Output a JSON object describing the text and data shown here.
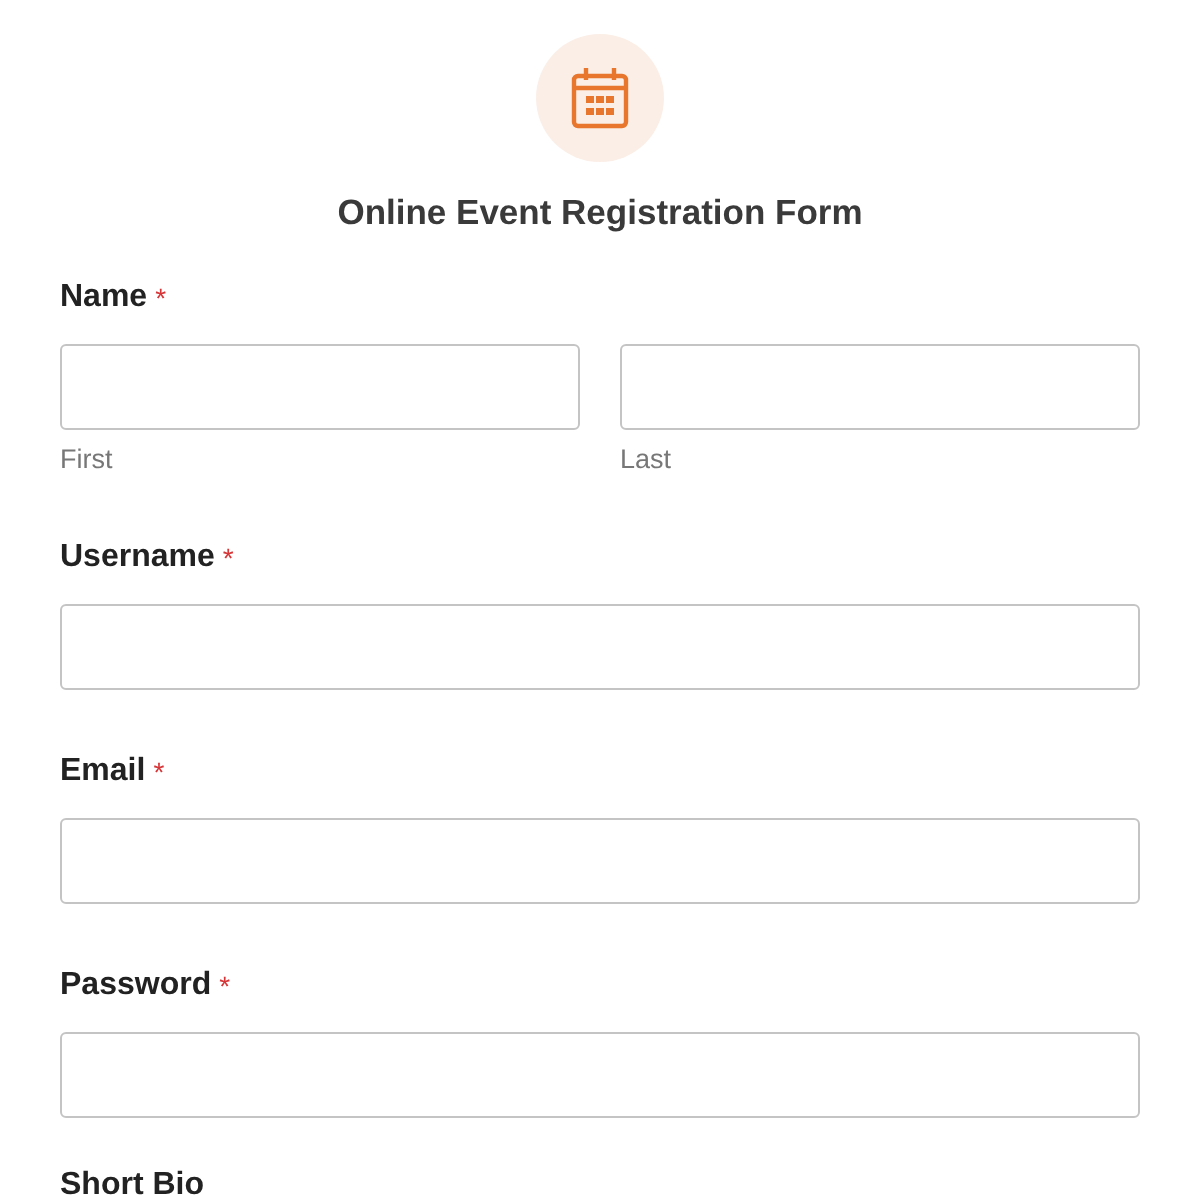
{
  "form": {
    "title": "Online Event Registration Form",
    "fields": [
      {
        "kind": "name",
        "label": "Name",
        "required_mark": "*",
        "sublabels": [
          "First",
          "Last"
        ]
      },
      {
        "kind": "text",
        "label": "Username",
        "required_mark": "*"
      },
      {
        "kind": "text",
        "label": "Email",
        "required_mark": "*"
      },
      {
        "kind": "text",
        "label": "Password",
        "required_mark": "*"
      },
      {
        "kind": "label",
        "label": "Short Bio"
      }
    ]
  }
}
